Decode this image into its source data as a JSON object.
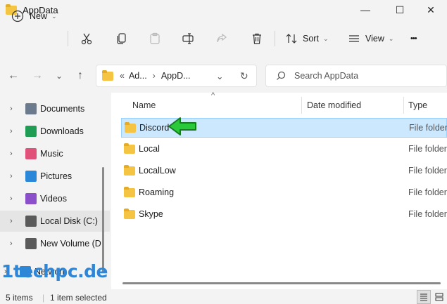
{
  "window": {
    "title": "AppData",
    "minimize": "—",
    "maximize": "☐",
    "close": "✕"
  },
  "toolbar": {
    "new_label": "New",
    "sort_label": "Sort",
    "view_label": "View",
    "more_label": "•••"
  },
  "nav": {
    "back": "←",
    "forward": "→",
    "recent": "⌄",
    "up": "↑"
  },
  "address": {
    "overflow": "«",
    "crumbs": [
      "Ad...",
      "AppD..."
    ],
    "separator": "›",
    "dropdown": "⌄",
    "refresh": "↻"
  },
  "search": {
    "placeholder": "Search AppData"
  },
  "sidebar": {
    "items": [
      {
        "label": "Documents",
        "icon": "documents-icon",
        "color": "#6b7a8c"
      },
      {
        "label": "Downloads",
        "icon": "downloads-icon",
        "color": "#1f9d55"
      },
      {
        "label": "Music",
        "icon": "music-icon",
        "color": "#e0527a"
      },
      {
        "label": "Pictures",
        "icon": "pictures-icon",
        "color": "#2b88d8"
      },
      {
        "label": "Videos",
        "icon": "videos-icon",
        "color": "#8b4fc9"
      },
      {
        "label": "Local Disk (C:)",
        "icon": "drive-icon",
        "color": "#5a5a5a"
      },
      {
        "label": "New Volume (D",
        "icon": "drive-icon",
        "color": "#5a5a5a"
      },
      {
        "label": "Network",
        "icon": "network-icon",
        "color": "#2b88d8"
      }
    ],
    "chevron": "›"
  },
  "columns": {
    "name": "Name",
    "date": "Date modified",
    "type": "Type",
    "sort_indicator": "^"
  },
  "rows": [
    {
      "name": "Discord",
      "type": "File folder"
    },
    {
      "name": "Local",
      "type": "File folder"
    },
    {
      "name": "LocalLow",
      "type": "File folder"
    },
    {
      "name": "Roaming",
      "type": "File folder"
    },
    {
      "name": "Skype",
      "type": "File folder"
    }
  ],
  "status": {
    "items": "5 items",
    "selected": "1 item selected"
  },
  "watermark": "1techpc.de",
  "colors": {
    "accent": "#0067c0",
    "selection": "#cce8ff",
    "arrow": "#29c93a"
  }
}
